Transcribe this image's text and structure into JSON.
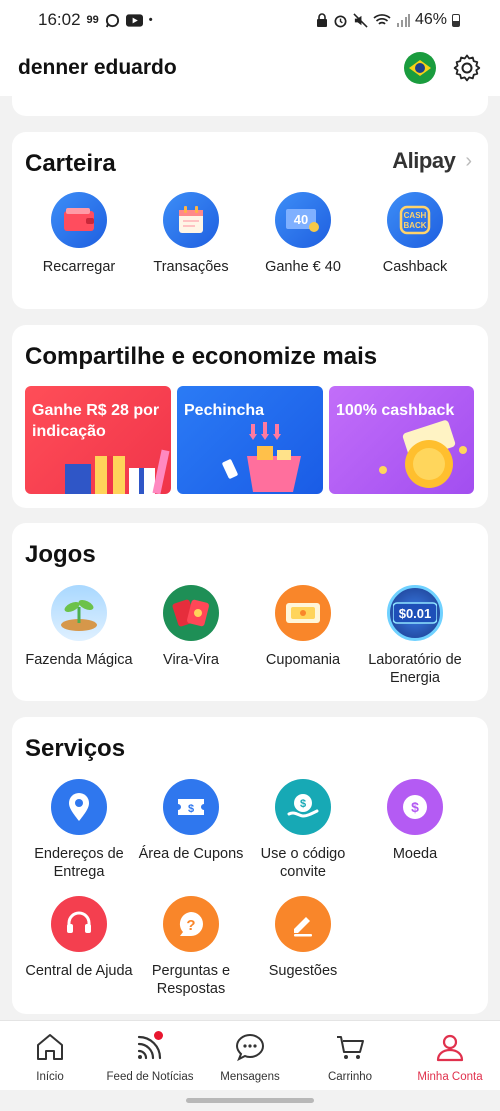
{
  "status_bar": {
    "time": "16:02",
    "left_icons": [
      "99",
      "whatsapp-icon",
      "youtube-icon",
      "•"
    ],
    "battery": "46%"
  },
  "header": {
    "user_name": "denner eduardo"
  },
  "wallet": {
    "title": "Carteira",
    "brand": "Alipay",
    "items": [
      {
        "label": "Recarregar",
        "icon": "wallet-icon"
      },
      {
        "label": "Transações",
        "icon": "calendar-icon"
      },
      {
        "label": "Ganhe € 40",
        "icon": "coupon-40-icon",
        "badge": "40"
      },
      {
        "label": "Cashback",
        "icon": "cashback-icon",
        "badge": "CASH BACK"
      }
    ]
  },
  "share": {
    "title": "Compartilhe e economize mais",
    "promos": [
      {
        "label": "Ganhe R$ 28 por indicação"
      },
      {
        "label": "Pechincha"
      },
      {
        "label": "100% cashback"
      }
    ]
  },
  "games": {
    "title": "Jogos",
    "items": [
      {
        "label": "Fazenda Mágica",
        "icon": "farm-icon"
      },
      {
        "label": "Vira-Vira",
        "icon": "cards-icon"
      },
      {
        "label": "Cupomania",
        "icon": "coupon-icon"
      },
      {
        "label": "Laboratório de Energia",
        "icon": "energy-lab-icon",
        "badge": "$0.01"
      }
    ]
  },
  "services": {
    "title": "Serviços",
    "items": [
      {
        "label": "Endereços de Entrega",
        "icon": "location-pin-icon"
      },
      {
        "label": "Área de Cupons",
        "icon": "ticket-icon"
      },
      {
        "label": "Use o código convite",
        "icon": "invite-code-icon"
      },
      {
        "label": "Moeda",
        "icon": "currency-icon"
      },
      {
        "label": "Central de Ajuda",
        "icon": "headset-icon"
      },
      {
        "label": "Perguntas e Respostas",
        "icon": "question-icon"
      },
      {
        "label": "Sugestões",
        "icon": "pencil-icon"
      }
    ]
  },
  "bottom_nav": {
    "items": [
      {
        "label": "Início",
        "icon": "home-icon"
      },
      {
        "label": "Feed de Notícias",
        "icon": "feed-icon"
      },
      {
        "label": "Mensagens",
        "icon": "chat-icon"
      },
      {
        "label": "Carrinho",
        "icon": "cart-icon"
      },
      {
        "label": "Minha Conta",
        "icon": "user-icon",
        "active": true
      }
    ]
  },
  "colors": {
    "accent_active": "#e0314d",
    "notification_dot": "#e8162f",
    "icon_blue": "#2f77ee",
    "icon_orange": "#f9862a",
    "icon_purple": "#b45bf3",
    "icon_red": "#f43f4f"
  }
}
